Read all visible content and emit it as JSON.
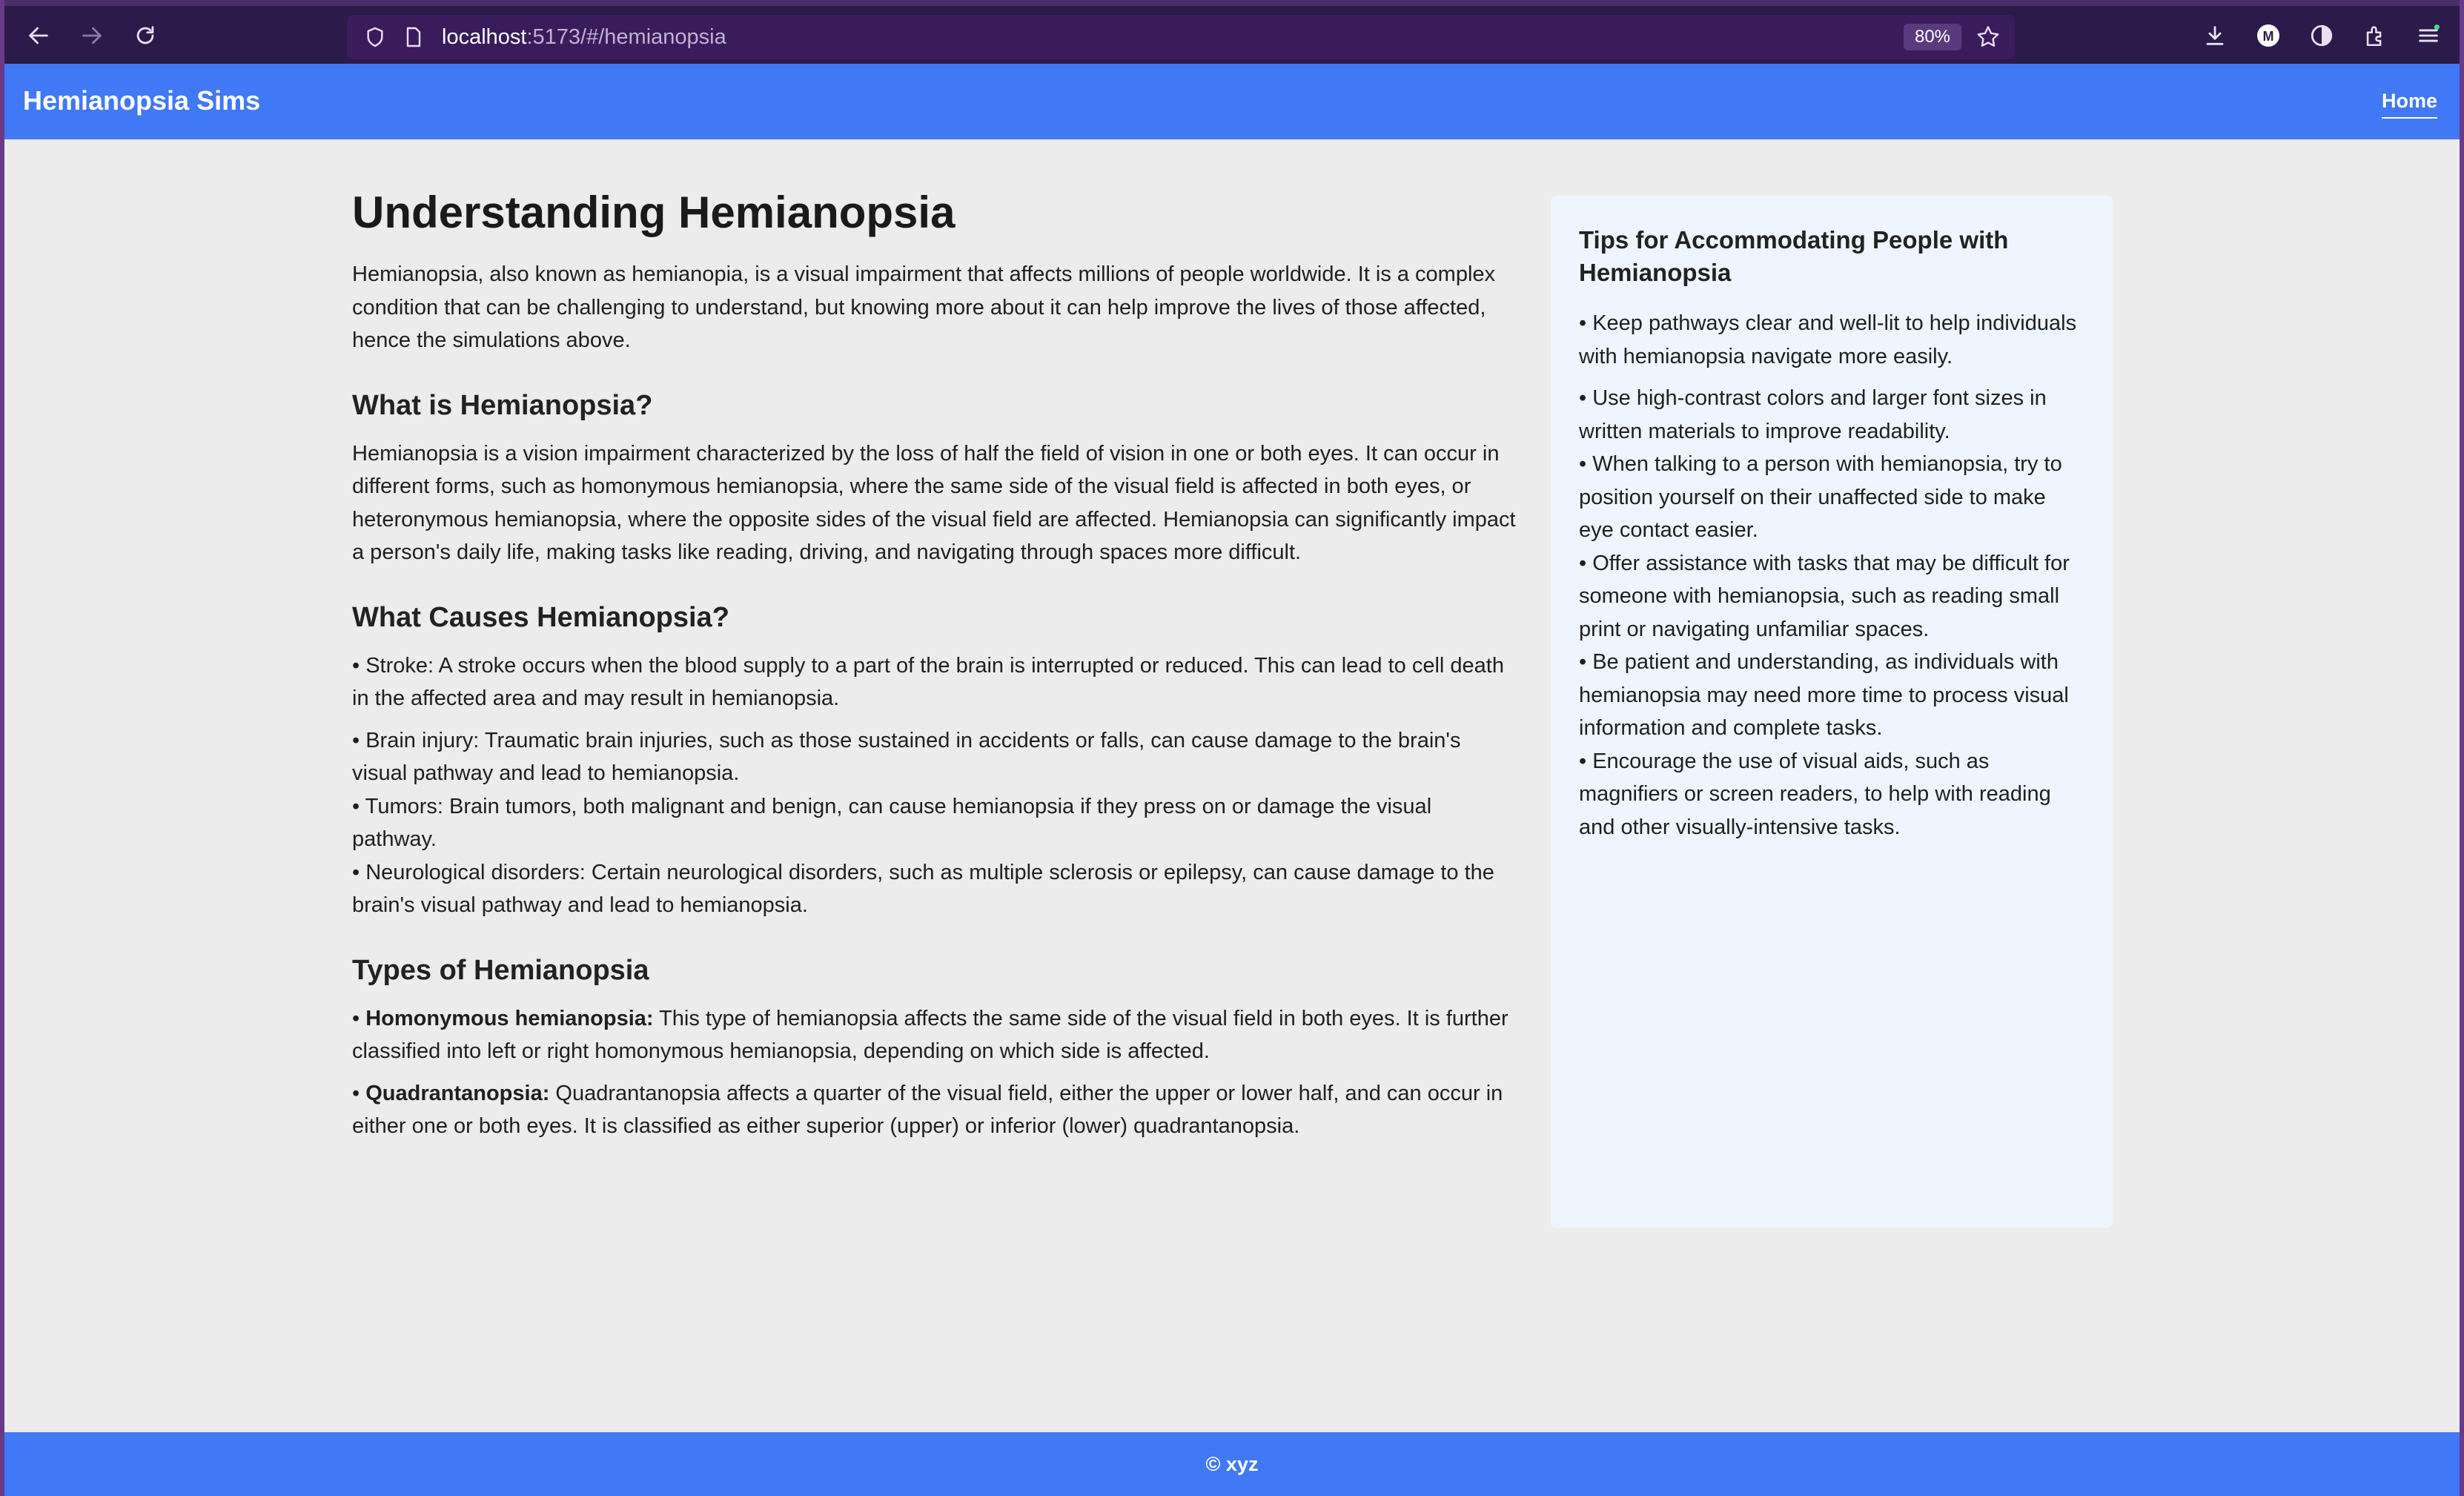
{
  "browser": {
    "url_host": "localhost",
    "url_path": ":5173/#/hemianopsia",
    "zoom": "80%"
  },
  "header": {
    "brand": "Hemianopsia Sims",
    "nav_home": "Home"
  },
  "main": {
    "title": "Understanding Hemianopsia",
    "intro": "Hemianopsia, also known as hemianopia, is a visual impairment that affects millions of people worldwide. It is a complex condition that can be challenging to understand, but knowing more about it can help improve the lives of those affected, hence the simulations above.",
    "what_heading": "What is Hemianopsia?",
    "what_text": "Hemianopsia is a vision impairment characterized by the loss of half the field of vision in one or both eyes. It can occur in different forms, such as homonymous hemianopsia, where the same side of the visual field is affected in both eyes, or heteronymous hemianopsia, where the opposite sides of the visual field are affected. Hemianopsia can significantly impact a person's daily life, making tasks like reading, driving, and navigating through spaces more difficult.",
    "causes_heading": "What Causes Hemianopsia?",
    "causes": [
      "• Stroke: A stroke occurs when the blood supply to a part of the brain is interrupted or reduced. This can lead to cell death in the affected area and may result in hemianopsia.",
      "• Brain injury: Traumatic brain injuries, such as those sustained in accidents or falls, can cause damage to the brain's visual pathway and lead to hemianopsia.",
      "• Tumors: Brain tumors, both malignant and benign, can cause hemianopsia if they press on or damage the visual pathway.",
      "• Neurological disorders: Certain neurological disorders, such as multiple sclerosis or epilepsy, can cause damage to the brain's visual pathway and lead to hemianopsia."
    ],
    "types_heading": "Types of Hemianopsia",
    "types": [
      {
        "bullet": "• ",
        "term": "Homonymous hemianopsia:",
        "text": " This type of hemianopsia affects the same side of the visual field in both eyes. It is further classified into left or right homonymous hemianopsia, depending on which side is affected."
      },
      {
        "bullet": "• ",
        "term": "Quadrantanopsia:",
        "text": " Quadrantanopsia affects a quarter of the visual field, either the upper or lower half, and can occur in either one or both eyes. It is classified as either superior (upper) or inferior (lower) quadrantanopsia."
      }
    ]
  },
  "tips": {
    "title": "Tips for Accommodating People with Hemianopsia",
    "items": [
      "• Keep pathways clear and well-lit to help individuals with hemianopsia navigate more easily.",
      "• Use high-contrast colors and larger font sizes in written materials to improve readability.",
      "• When talking to a person with hemianopsia, try to position yourself on their unaffected side to make eye contact easier.",
      "• Offer assistance with tasks that may be difficult for someone with hemianopsia, such as reading small print or navigating unfamiliar spaces.",
      "• Be patient and understanding, as individuals with hemianopsia may need more time to process visual information and complete tasks.",
      "• Encourage the use of visual aids, such as magnifiers or screen readers, to help with reading and other visually-intensive tasks."
    ]
  },
  "footer": {
    "text": "© xyz"
  },
  "colors": {
    "accent": "#4178f5",
    "browser_chrome": "#2b1a4a",
    "page_bg": "#ececec",
    "tips_bg": "#eef5ff"
  },
  "icons": [
    "back-icon",
    "forward-icon",
    "reload-icon",
    "shield-icon",
    "page-icon",
    "star-icon",
    "download-icon",
    "account-icon",
    "extension-badge-icon",
    "extensions-icon",
    "menu-icon"
  ]
}
